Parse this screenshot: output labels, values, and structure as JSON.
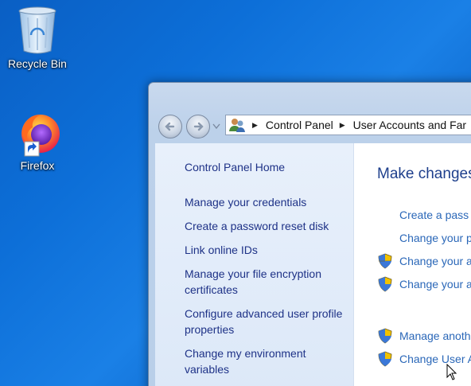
{
  "desktop": {
    "icons": [
      {
        "label": "Recycle Bin",
        "icon": "recycle-bin-icon"
      },
      {
        "label": "Firefox",
        "icon": "firefox-icon"
      }
    ]
  },
  "window": {
    "address": {
      "segments": [
        "Control Panel",
        "User Accounts and Far"
      ]
    },
    "sidebar": {
      "home": "Control Panel Home",
      "links": [
        "Manage your credentials",
        "Create a password reset disk",
        "Link online IDs",
        "Manage your file encryption certificates",
        "Configure advanced user profile properties",
        "Change my environment variables"
      ]
    },
    "main": {
      "heading": "Make changes",
      "tasks": [
        {
          "label": "Create a pass",
          "shield": false
        },
        {
          "label": "Change your p",
          "shield": false
        },
        {
          "label": "Change your a",
          "shield": true
        },
        {
          "label": "Change your a",
          "shield": true
        },
        {
          "label": "Manage anoth",
          "shield": true
        },
        {
          "label": "Change User A",
          "shield": true
        }
      ]
    }
  },
  "colors": {
    "link": "#1e3287",
    "task_link": "#2a67b8",
    "heading": "#1e3f8c"
  }
}
